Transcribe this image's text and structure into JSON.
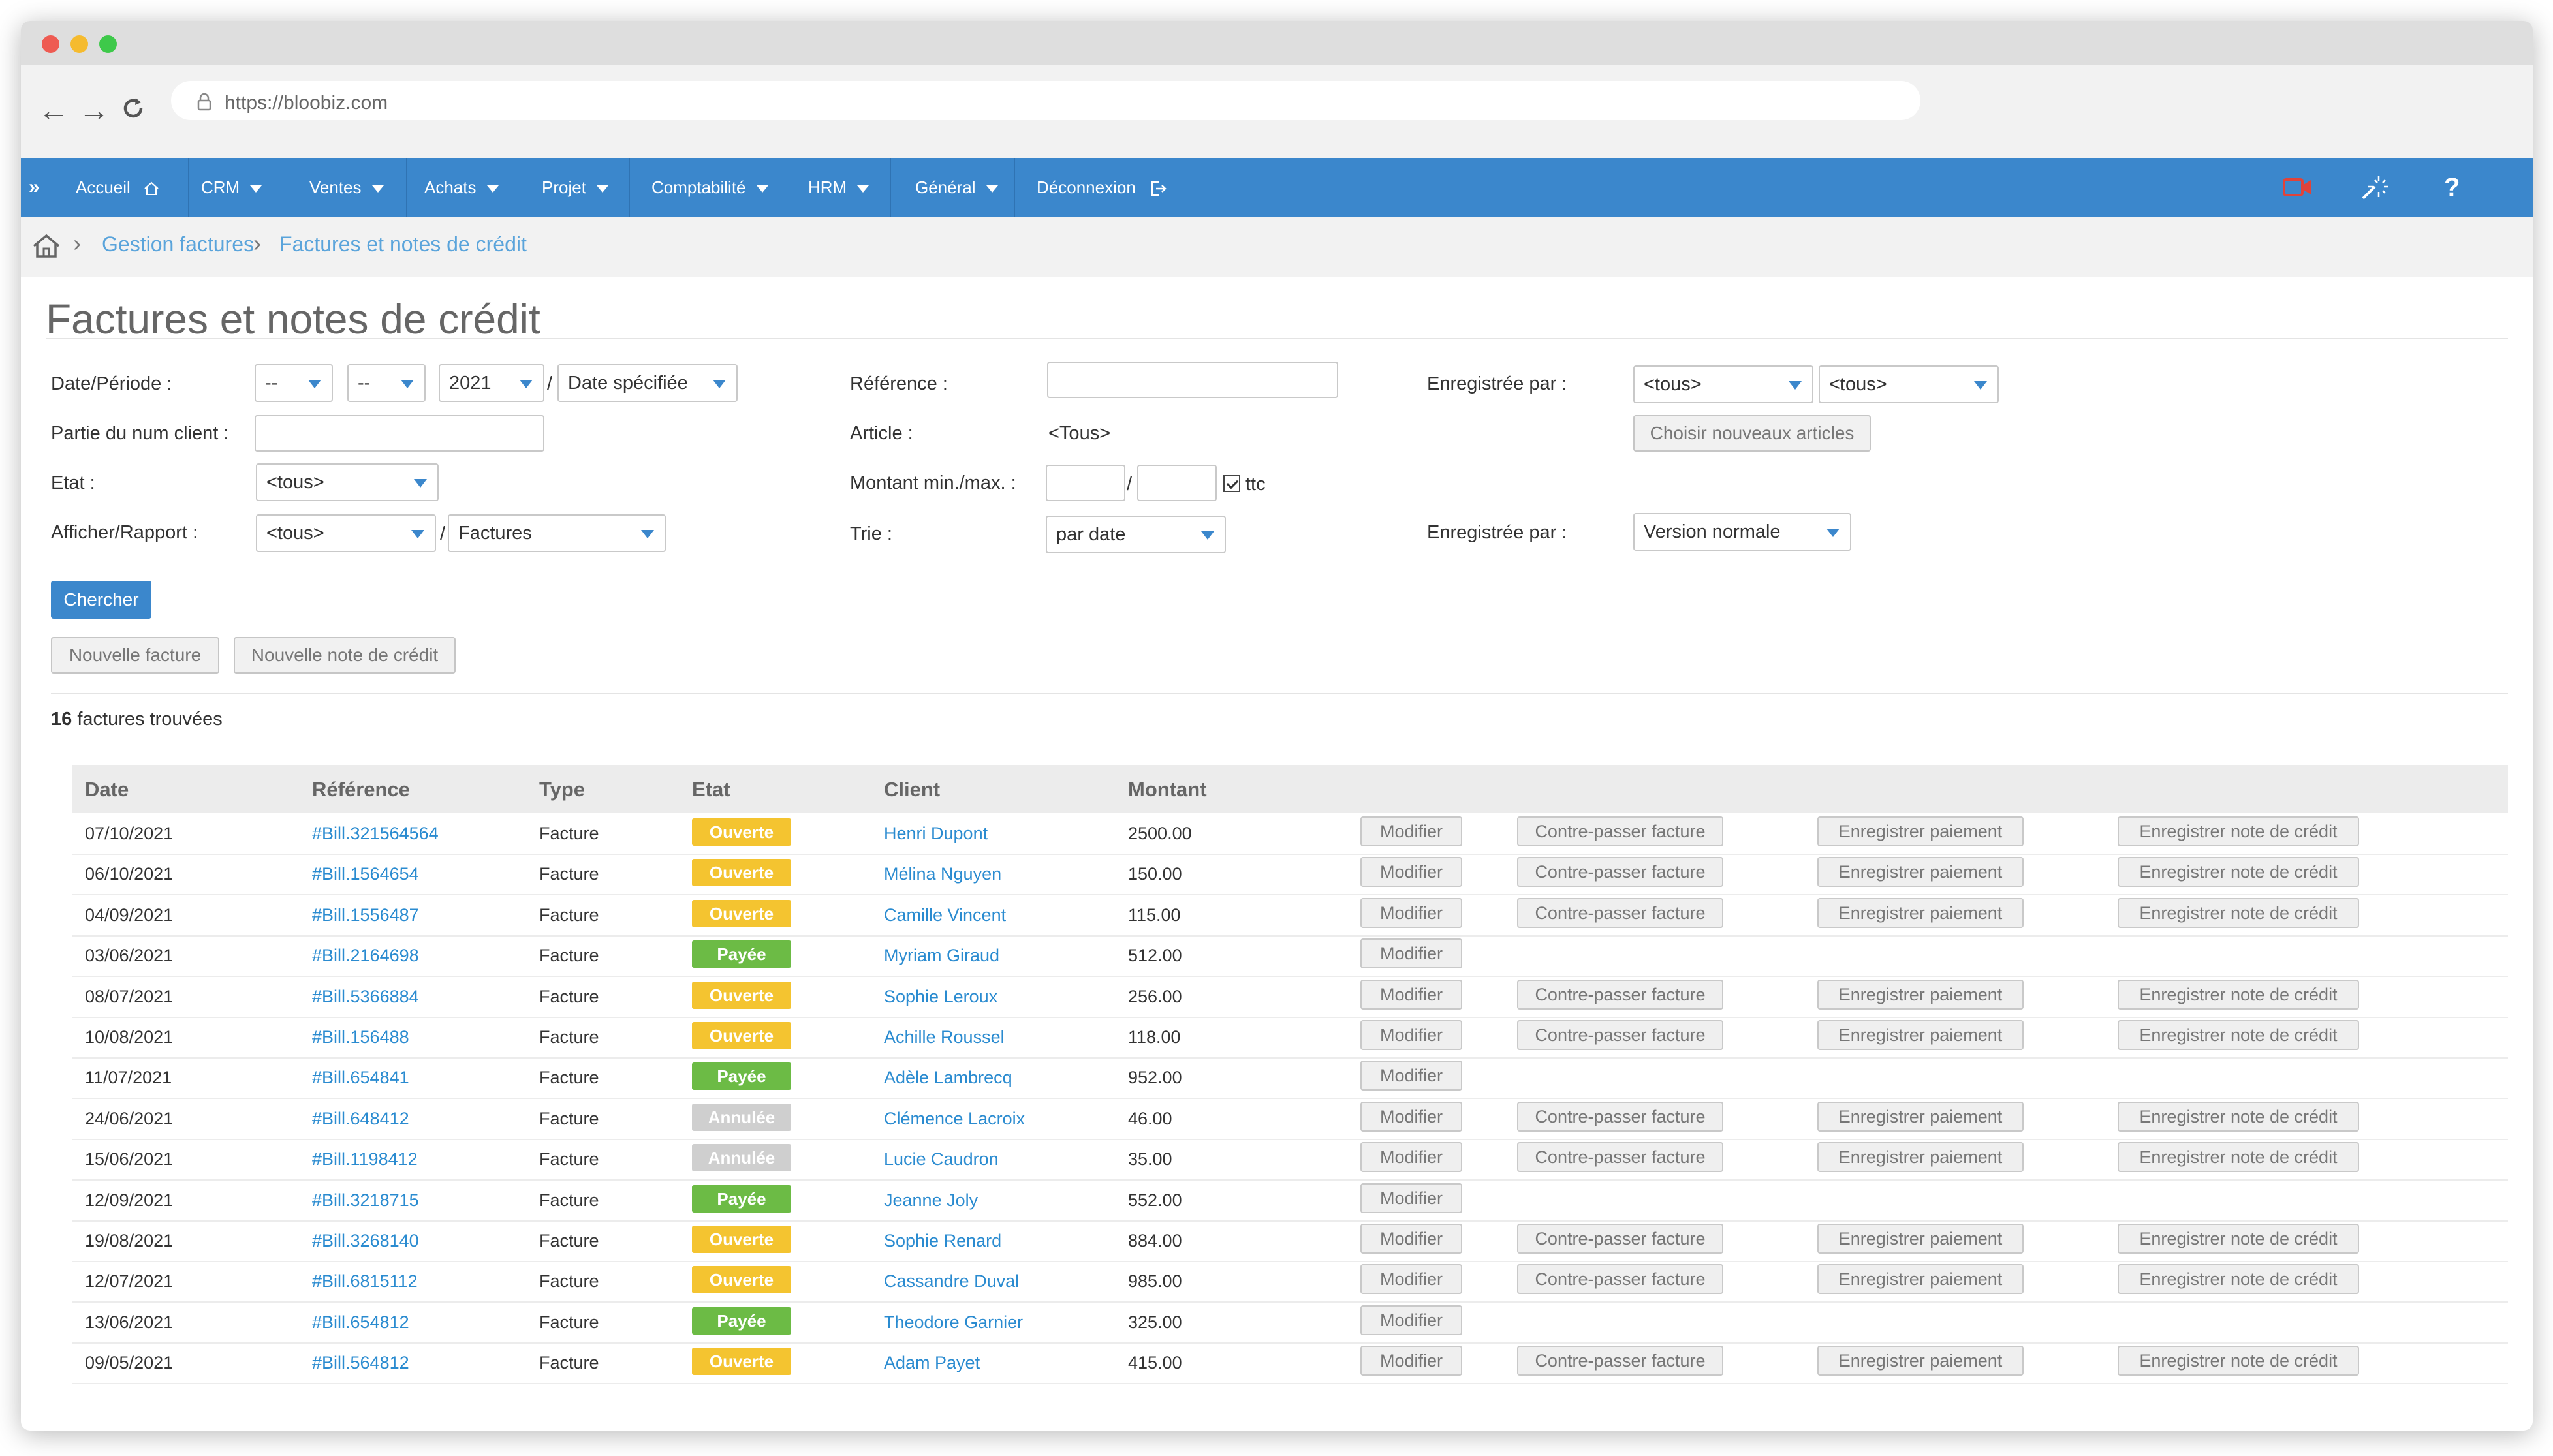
{
  "browser": {
    "url": "https://bloobiz.com"
  },
  "nav": {
    "items": [
      {
        "label": "Accueil"
      },
      {
        "label": "CRM"
      },
      {
        "label": "Ventes"
      },
      {
        "label": "Achats"
      },
      {
        "label": "Projet"
      },
      {
        "label": "Comptabilité"
      },
      {
        "label": "HRM"
      },
      {
        "label": "Général"
      },
      {
        "label": "Déconnexion"
      }
    ],
    "expand_glyph": "»",
    "help_glyph": "?",
    "colors": {
      "bar": "#3b87cc",
      "camera_icon": "#e0433a"
    }
  },
  "breadcrumb": [
    "Gestion factures",
    "Factures et notes de crédit"
  ],
  "page": {
    "title": "Factures et notes de crédit"
  },
  "filters": {
    "date_label": "Date/Période :",
    "date_day": "--",
    "date_month": "--",
    "date_year": "2021",
    "date_slash": "/",
    "date_mode": "Date spécifiée",
    "client_label": "Partie du num client :",
    "etat_label": "Etat :",
    "etat_value": "<tous>",
    "afficher_label": "Afficher/Rapport :",
    "afficher_value": "<tous>",
    "rapport_slash": "/",
    "rapport_value": "Factures",
    "reference_label": "Référence :",
    "article_label": "Article :",
    "article_value": "<Tous>",
    "montant_label": "Montant min./max. :",
    "montant_slash": "/",
    "ttc_label": "ttc",
    "trie_label": "Trie :",
    "trie_value": "par date",
    "enreg1_label": "Enregistrée par :",
    "enreg1_value_a": "<tous>",
    "enreg1_value_b": "<tous>",
    "choisir_button": "Choisir nouveaux articles",
    "enreg2_label": "Enregistrée par :",
    "enreg2_value": "Version normale"
  },
  "actions": {
    "search_button": "Chercher",
    "new_invoice_button": "Nouvelle facture",
    "new_credit_button": "Nouvelle note de crédit"
  },
  "results": {
    "count": "16",
    "count_suffix": "factures trouvées"
  },
  "table": {
    "headers": [
      "Date",
      "Référence",
      "Type",
      "Etat",
      "Client",
      "Montant"
    ],
    "button_labels": {
      "modify": "Modifier",
      "reverse": "Contre-passer facture",
      "payment": "Enregistrer paiement",
      "credit": "Enregistrer note de crédit"
    },
    "status_colors": {
      "Ouverte": "#f4c430",
      "Payée": "#6cbb45",
      "Annulée": "#cfcfcf"
    },
    "rows": [
      {
        "date": "07/10/2021",
        "ref": "#Bill.321564564",
        "type": "Facture",
        "status": "Ouverte",
        "client": "Henri Dupont",
        "amount": "2500.00",
        "actions": true
      },
      {
        "date": "06/10/2021",
        "ref": "#Bill.1564654",
        "type": "Facture",
        "status": "Ouverte",
        "client": "Mélina Nguyen",
        "amount": "150.00",
        "actions": true
      },
      {
        "date": "04/09/2021",
        "ref": "#Bill.1556487",
        "type": "Facture",
        "status": "Ouverte",
        "client": "Camille Vincent",
        "amount": "115.00",
        "actions": true
      },
      {
        "date": "03/06/2021",
        "ref": "#Bill.2164698",
        "type": "Facture",
        "status": "Payée",
        "client": "Myriam Giraud",
        "amount": "512.00",
        "actions": false
      },
      {
        "date": "08/07/2021",
        "ref": "#Bill.5366884",
        "type": "Facture",
        "status": "Ouverte",
        "client": "Sophie Leroux",
        "amount": "256.00",
        "actions": true
      },
      {
        "date": "10/08/2021",
        "ref": "#Bill.156488",
        "type": "Facture",
        "status": "Ouverte",
        "client": "Achille Roussel",
        "amount": "118.00",
        "actions": true
      },
      {
        "date": "11/07/2021",
        "ref": "#Bill.654841",
        "type": "Facture",
        "status": "Payée",
        "client": "Adèle Lambrecq",
        "amount": "952.00",
        "actions": false
      },
      {
        "date": "24/06/2021",
        "ref": "#Bill.648412",
        "type": "Facture",
        "status": "Annulée",
        "client": "Clémence Lacroix",
        "amount": "46.00",
        "actions": true
      },
      {
        "date": "15/06/2021",
        "ref": "#Bill.1198412",
        "type": "Facture",
        "status": "Annulée",
        "client": "Lucie Caudron",
        "amount": "35.00",
        "actions": true
      },
      {
        "date": "12/09/2021",
        "ref": "#Bill.3218715",
        "type": "Facture",
        "status": "Payée",
        "client": "Jeanne Joly",
        "amount": "552.00",
        "actions": false
      },
      {
        "date": "19/08/2021",
        "ref": "#Bill.3268140",
        "type": "Facture",
        "status": "Ouverte",
        "client": "Sophie Renard",
        "amount": "884.00",
        "actions": true
      },
      {
        "date": "12/07/2021",
        "ref": "#Bill.6815112",
        "type": "Facture",
        "status": "Ouverte",
        "client": "Cassandre Duval",
        "amount": "985.00",
        "actions": true
      },
      {
        "date": "13/06/2021",
        "ref": "#Bill.654812",
        "type": "Facture",
        "status": "Payée",
        "client": "Theodore Garnier",
        "amount": "325.00",
        "actions": false
      },
      {
        "date": "09/05/2021",
        "ref": "#Bill.564812",
        "type": "Facture",
        "status": "Ouverte",
        "client": "Adam Payet",
        "amount": "415.00",
        "actions": true
      }
    ]
  }
}
